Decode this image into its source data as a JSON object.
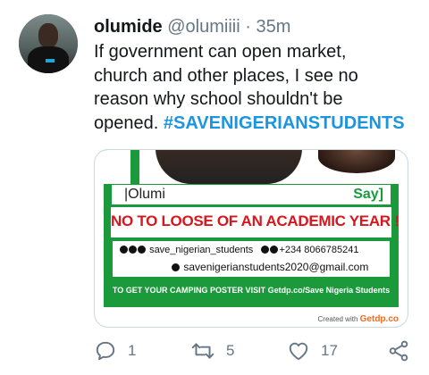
{
  "tweet": {
    "display_name": "olumide",
    "handle": "@olumiiii",
    "separator": "·",
    "time": "35m",
    "text_lines": [
      "If government can open market,",
      "church and other places, I see no",
      "reason why school shouldn't be",
      "opened."
    ],
    "hashtag": "#SAVENIGERIANSTUDENTS"
  },
  "media": {
    "name": "|Olumi",
    "say": "Say]",
    "slogan": "NO TO LOOSE OF AN ACADEMIC YEAR !",
    "social_handle": "save_nigerian_students",
    "phone": "+234 8066785241",
    "email": "savenigerianstudents2020@gmail.com",
    "camping_line": "TO GET YOUR CAMPING POSTER VISIT Getdp.co/Save Nigeria Students",
    "created_with_label": "Created with",
    "created_with_brand": "Getdp.co"
  },
  "actions": {
    "reply_count": "1",
    "retweet_count": "5",
    "like_count": "17"
  },
  "colors": {
    "hashtag": "#1b95e0",
    "poster_green": "#1a9a3a",
    "slogan_red": "#d7161d",
    "muted": "#657786"
  },
  "icons": [
    "reply-icon",
    "retweet-icon",
    "like-icon",
    "share-icon"
  ]
}
